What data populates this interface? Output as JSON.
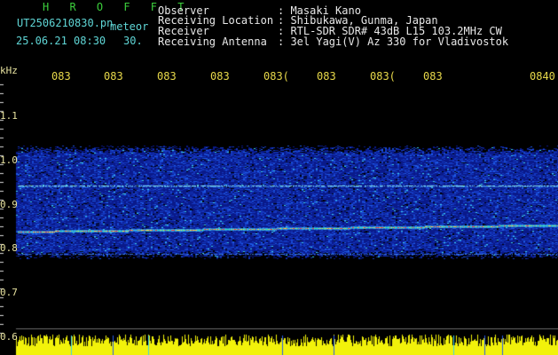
{
  "header": {
    "brand": "H R O F F T",
    "filename": "UT2506210830.pn",
    "mode": "meteor",
    "datetime": "25.06.21 08:30",
    "interval": "30.",
    "fields": [
      {
        "label": "Observer",
        "value": ": Masaki Kano"
      },
      {
        "label": "Receiving Location",
        "value": ": Shibukawa, Gunma, Japan"
      },
      {
        "label": "Receiver",
        "value": ": RTL-SDR SDR# 43dB L15 103.2MHz CW"
      },
      {
        "label": "Receiving Antenna",
        "value": ": 3el Yagi(V) Az 330 for Vladivostok"
      }
    ]
  },
  "axis": {
    "unit": "kHz",
    "y_ticks": [
      "1.1",
      "1.0",
      "0.9",
      "0.8",
      "0.7",
      "0.6"
    ],
    "x_ticks": [
      "083",
      "083",
      "083",
      "083",
      "083(",
      "083",
      "083(",
      "083",
      "0840"
    ]
  },
  "colors": {
    "background": "#000000",
    "header_text": "#e8e8e8",
    "brand": "#3ccf3c",
    "file_text": "#5fd6d6",
    "tick_text": "#e8d94a",
    "noise_base": "#0a1a8a",
    "signal_line": "#ff3b3b",
    "bottom_bar": "#f2f20a"
  }
}
